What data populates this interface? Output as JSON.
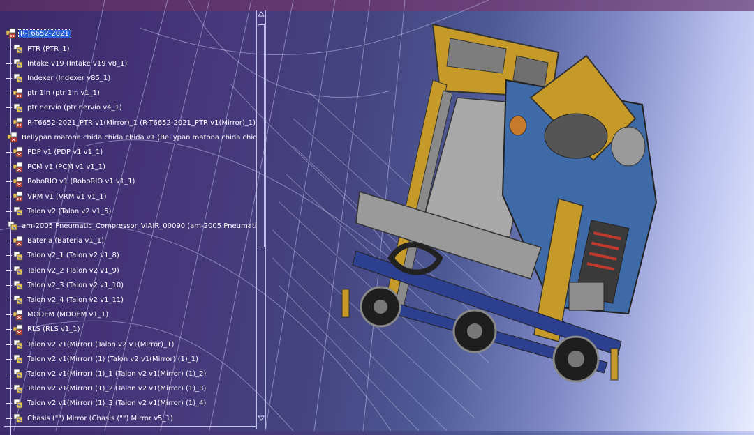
{
  "window": {
    "title": ""
  },
  "colors": {
    "background_start": "#3a2a6a",
    "background_end": "#e8ecff",
    "selection": "#2a63d6",
    "tree_text": "#ffffff",
    "robot_frame": "#c09520",
    "robot_panel": "#3f6aa8"
  },
  "tree": {
    "root": {
      "label": "R-T6652-2021",
      "icon": "product-icon",
      "selected": true
    },
    "items": [
      {
        "label": "PTR (PTR_1)",
        "icon": "part-icon"
      },
      {
        "label": "Intake v19 (Intake v19 v8_1)",
        "icon": "part-icon"
      },
      {
        "label": "Indexer (Indexer v85_1)",
        "icon": "part-icon"
      },
      {
        "label": "ptr 1in (ptr 1in v1_1)",
        "icon": "product-icon"
      },
      {
        "label": "ptr nervio (ptr nervio v4_1)",
        "icon": "part-icon"
      },
      {
        "label": "R-T6652-2021_PTR v1(Mirror)_1 (R-T6652-2021_PTR v1(Mirror)_1)",
        "icon": "product-icon"
      },
      {
        "label": "Bellypan matona chida chida chida v1 (Bellypan matona chida chid",
        "icon": "product-icon"
      },
      {
        "label": "PDP v1 (PDP v1 v1_1)",
        "icon": "product-icon"
      },
      {
        "label": "PCM v1 (PCM v1 v1_1)",
        "icon": "product-icon"
      },
      {
        "label": "RoboRIO v1 (RoboRIO v1 v1_1)",
        "icon": "product-icon"
      },
      {
        "label": "VRM v1 (VRM v1 v1_1)",
        "icon": "product-icon"
      },
      {
        "label": "Talon v2 (Talon v2 v1_5)",
        "icon": "part-icon"
      },
      {
        "label": "am-2005 Pneumatic_Compressor_VIAIR_00090 (am-2005 Pneumatic",
        "icon": "part-icon"
      },
      {
        "label": "Bateria (Bateria v1_1)",
        "icon": "product-icon"
      },
      {
        "label": "Talon v2_1 (Talon v2 v1_8)",
        "icon": "part-icon"
      },
      {
        "label": "Talon v2_2 (Talon v2 v1_9)",
        "icon": "part-icon"
      },
      {
        "label": "Talon v2_3 (Talon v2 v1_10)",
        "icon": "part-icon"
      },
      {
        "label": "Talon v2_4 (Talon v2 v1_11)",
        "icon": "part-icon"
      },
      {
        "label": "MODEM (MODEM v1_1)",
        "icon": "product-icon"
      },
      {
        "label": "RLS (RLS v1_1)",
        "icon": "product-icon"
      },
      {
        "label": "Talon v2 v1(Mirror) (Talon v2 v1(Mirror)_1)",
        "icon": "part-icon"
      },
      {
        "label": "Talon v2 v1(Mirror) (1) (Talon v2 v1(Mirror) (1)_1)",
        "icon": "part-icon"
      },
      {
        "label": "Talon v2 v1(Mirror) (1)_1 (Talon v2 v1(Mirror) (1)_2)",
        "icon": "part-icon"
      },
      {
        "label": "Talon v2 v1(Mirror) (1)_2 (Talon v2 v1(Mirror) (1)_3)",
        "icon": "part-icon"
      },
      {
        "label": "Talon v2 v1(Mirror) (1)_3 (Talon v2 v1(Mirror) (1)_4)",
        "icon": "part-icon"
      },
      {
        "label": "Chasis (\"\") Mirror (Chasis (\"\") Mirror v5_1)",
        "icon": "part-icon"
      }
    ]
  }
}
